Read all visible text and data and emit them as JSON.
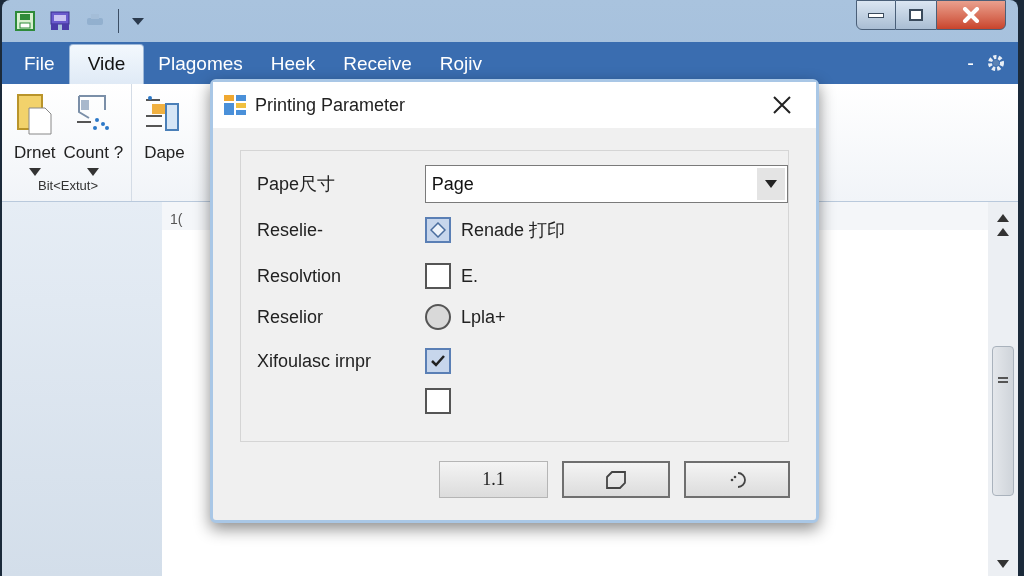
{
  "tabs": [
    {
      "label": "File",
      "selected": false
    },
    {
      "label": "Vide",
      "selected": true
    },
    {
      "label": "Plagomes",
      "selected": false
    },
    {
      "label": "Heek",
      "selected": false
    },
    {
      "label": "Receive",
      "selected": false
    },
    {
      "label": "Rojiv",
      "selected": false
    }
  ],
  "ribbon": {
    "commands": [
      {
        "label": "Drnet"
      },
      {
        "label": "Count ?"
      },
      {
        "label": "Dape"
      }
    ],
    "group_label": "Bit<Extut>",
    "collapse_label": "-"
  },
  "document": {
    "ruler_text": "1("
  },
  "dialog": {
    "title": "Printing Parameter",
    "rows": [
      {
        "kind": "dropdown",
        "label": "Pape尺寸",
        "value": "Page"
      },
      {
        "kind": "diamond",
        "label": "Reselie-",
        "checked": true,
        "text": "Renade 打印"
      },
      {
        "kind": "checkbox",
        "label": "Resolvtion",
        "checked": false,
        "text": "E."
      },
      {
        "kind": "radio",
        "label": "Reselior",
        "checked": false,
        "text": "Lpla+"
      },
      {
        "kind": "checkbox",
        "label": "Xifoulasc irnpr",
        "checked": true
      },
      {
        "kind": "checkbox",
        "checked": false
      }
    ],
    "buttons": [
      {
        "kind": "text",
        "label": "1.1"
      },
      {
        "kind": "icon"
      },
      {
        "kind": "icon"
      }
    ]
  }
}
